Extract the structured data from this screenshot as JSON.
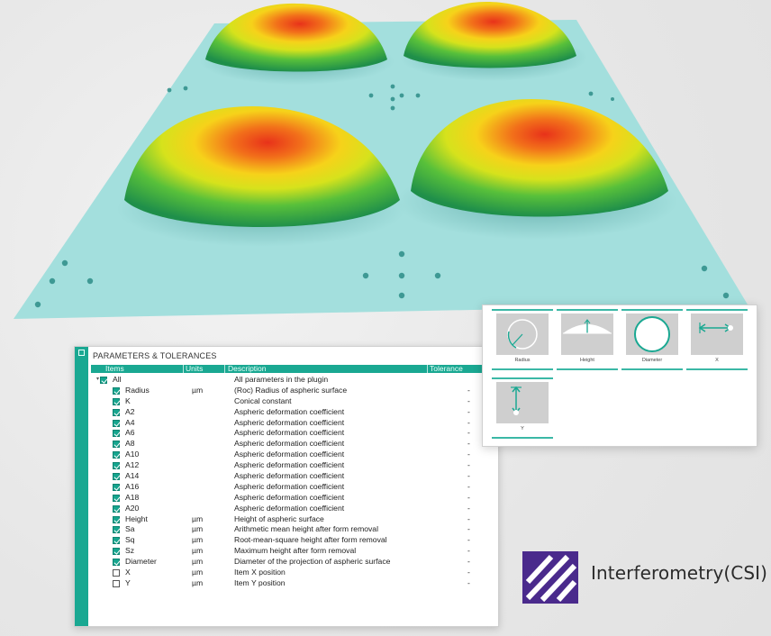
{
  "panel": {
    "title": "PARAMETERS & TOLERANCES",
    "columns": [
      "Items",
      "Units",
      "Description",
      "Tolerance"
    ],
    "rows": [
      {
        "item": "All",
        "unit": "",
        "desc": "All parameters in the plugin",
        "tol": "",
        "checked": true,
        "level": 0
      },
      {
        "item": "Radius",
        "unit": "µm",
        "desc": "(Roc) Radius of aspheric surface",
        "tol": "-",
        "checked": true,
        "level": 1
      },
      {
        "item": "K",
        "unit": "",
        "desc": "Conical constant",
        "tol": "-",
        "checked": true,
        "level": 1
      },
      {
        "item": "A2",
        "unit": "",
        "desc": "Aspheric deformation coefficient",
        "tol": "-",
        "checked": true,
        "level": 1
      },
      {
        "item": "A4",
        "unit": "",
        "desc": "Aspheric deformation coefficient",
        "tol": "-",
        "checked": true,
        "level": 1
      },
      {
        "item": "A6",
        "unit": "",
        "desc": "Aspheric deformation coefficient",
        "tol": "-",
        "checked": true,
        "level": 1
      },
      {
        "item": "A8",
        "unit": "",
        "desc": "Aspheric deformation coefficient",
        "tol": "-",
        "checked": true,
        "level": 1
      },
      {
        "item": "A10",
        "unit": "",
        "desc": "Aspheric deformation coefficient",
        "tol": "-",
        "checked": true,
        "level": 1
      },
      {
        "item": "A12",
        "unit": "",
        "desc": "Aspheric deformation coefficient",
        "tol": "-",
        "checked": true,
        "level": 1
      },
      {
        "item": "A14",
        "unit": "",
        "desc": "Aspheric deformation coefficient",
        "tol": "-",
        "checked": true,
        "level": 1
      },
      {
        "item": "A16",
        "unit": "",
        "desc": "Aspheric deformation coefficient",
        "tol": "-",
        "checked": true,
        "level": 1
      },
      {
        "item": "A18",
        "unit": "",
        "desc": "Aspheric deformation coefficient",
        "tol": "-",
        "checked": true,
        "level": 1
      },
      {
        "item": "A20",
        "unit": "",
        "desc": "Aspheric deformation coefficient",
        "tol": "-",
        "checked": true,
        "level": 1
      },
      {
        "item": "Height",
        "unit": "µm",
        "desc": "Height of aspheric surface",
        "tol": "-",
        "checked": true,
        "level": 1
      },
      {
        "item": "Sa",
        "unit": "µm",
        "desc": "Arithmetic mean height after form removal",
        "tol": "-",
        "checked": true,
        "level": 1
      },
      {
        "item": "Sq",
        "unit": "µm",
        "desc": "Root-mean-square height after form removal",
        "tol": "-",
        "checked": true,
        "level": 1
      },
      {
        "item": "Sz",
        "unit": "µm",
        "desc": "Maximum height after form removal",
        "tol": "-",
        "checked": true,
        "level": 1
      },
      {
        "item": "Diameter",
        "unit": "µm",
        "desc": "Diameter of the projection of aspheric surface",
        "tol": "-",
        "checked": true,
        "level": 1
      },
      {
        "item": "X",
        "unit": "µm",
        "desc": "Item X position",
        "tol": "-",
        "checked": false,
        "level": 1
      },
      {
        "item": "Y",
        "unit": "µm",
        "desc": "Item Y position",
        "tol": "-",
        "checked": false,
        "level": 1
      }
    ]
  },
  "shapes": {
    "items": [
      {
        "label": "Radius",
        "icon": "radius-icon"
      },
      {
        "label": "Height",
        "icon": "height-icon"
      },
      {
        "label": "Diameter",
        "icon": "diameter-icon"
      },
      {
        "label": "X",
        "icon": "x-arrow-icon"
      },
      {
        "label": "Y",
        "icon": "y-arrow-icon"
      }
    ]
  },
  "brand": {
    "text": "Interferometry(CSI)",
    "logo": "stripes-logo-icon"
  },
  "colors": {
    "accent": "#1aa892",
    "surface_base": "#9fdcda",
    "logo": "#4a2a8c"
  }
}
